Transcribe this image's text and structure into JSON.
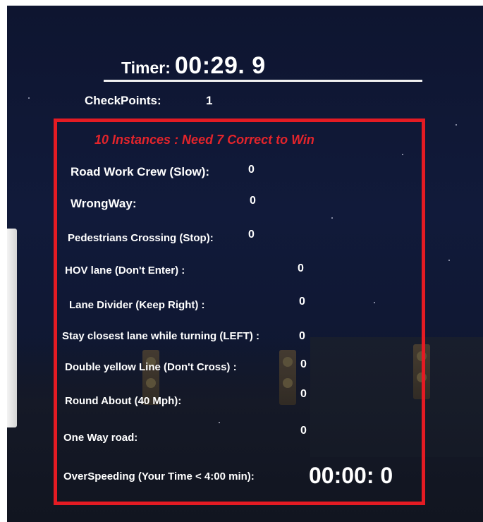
{
  "hud": {
    "timer_label": "Timer:",
    "timer_value": "00:29. 9",
    "checkpoints_label": "CheckPoints:",
    "checkpoints_value": "1"
  },
  "instances": {
    "header": "10 Instances : Need 7 Correct to Win",
    "items": [
      {
        "label": "Road Work Crew (Slow):",
        "value": "0"
      },
      {
        "label": "WrongWay:",
        "value": "0"
      },
      {
        "label": "Pedestrians Crossing (Stop):",
        "value": "0"
      },
      {
        "label": "HOV lane (Don't Enter) :",
        "value": "0"
      },
      {
        "label": "Lane Divider (Keep Right) :",
        "value": "0"
      },
      {
        "label": "Stay closest lane while turning (LEFT) :",
        "value": "0"
      },
      {
        "label": "Double yellow Line (Don't Cross) :",
        "value": "0"
      },
      {
        "label": "Round About (40 Mph):",
        "value": "0"
      },
      {
        "label": "One Way road:",
        "value": "0"
      }
    ],
    "overspeeding_label": "OverSpeeding (Your Time < 4:00 min):",
    "overspeeding_value": "00:00: 0"
  },
  "colors": {
    "accent_red": "#e41b23",
    "night_sky": "#111a3a",
    "text": "#ffffff"
  }
}
